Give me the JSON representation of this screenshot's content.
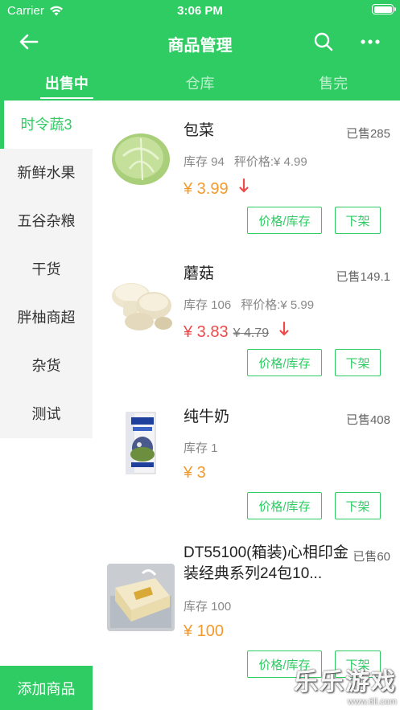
{
  "status_bar": {
    "carrier": "Carrier",
    "time": "3:06 PM"
  },
  "nav": {
    "title": "商品管理",
    "back_icon": "arrow-left-icon",
    "search_icon": "search-icon",
    "more_icon": "more-icon"
  },
  "tabs": [
    {
      "label": "出售中",
      "active": true
    },
    {
      "label": "仓库",
      "active": false
    },
    {
      "label": "售完",
      "active": false
    }
  ],
  "sidebar": {
    "categories": [
      {
        "label": "时令蔬3",
        "active": true
      },
      {
        "label": "新鲜水果",
        "active": false
      },
      {
        "label": "五谷杂粮",
        "active": false
      },
      {
        "label": "干货",
        "active": false
      },
      {
        "label": "胖柚商超",
        "active": false
      },
      {
        "label": "杂货",
        "active": false
      },
      {
        "label": "测试",
        "active": false
      }
    ],
    "add_button": "添加商品"
  },
  "products": [
    {
      "name": "包菜",
      "sold": "已售285",
      "stock": "库存 94",
      "ref_price": "秤价格:¥ 4.99",
      "price": "¥ 3.99",
      "old_price": "",
      "price_down": true,
      "image": "cabbage"
    },
    {
      "name": "蘑菇",
      "sold": "已售149.1",
      "stock": "库存 106",
      "ref_price": "秤价格:¥ 5.99",
      "price": "¥ 3.83",
      "old_price": "¥ 4.79",
      "price_down": true,
      "image": "mushroom"
    },
    {
      "name": "纯牛奶",
      "sold": "已售408",
      "stock": "库存 1",
      "ref_price": "",
      "price": "¥ 3",
      "old_price": "",
      "price_down": false,
      "image": "milk-carton"
    },
    {
      "name": "DT55100(箱装)心相印金装经典系列24包10...",
      "sold": "已售60",
      "stock": "库存 100",
      "ref_price": "",
      "price": "¥ 100",
      "old_price": "",
      "price_down": false,
      "image": "tissue-pack"
    }
  ],
  "buttons": {
    "price_stock": "价格/库存",
    "off_shelf": "下架"
  },
  "watermark": {
    "main": "乐乐游戏",
    "sub": "www.6ll.com"
  },
  "colors": {
    "primary": "#2ecc63",
    "price_orange": "#f39a2e",
    "price_red": "#ef4a4a"
  }
}
